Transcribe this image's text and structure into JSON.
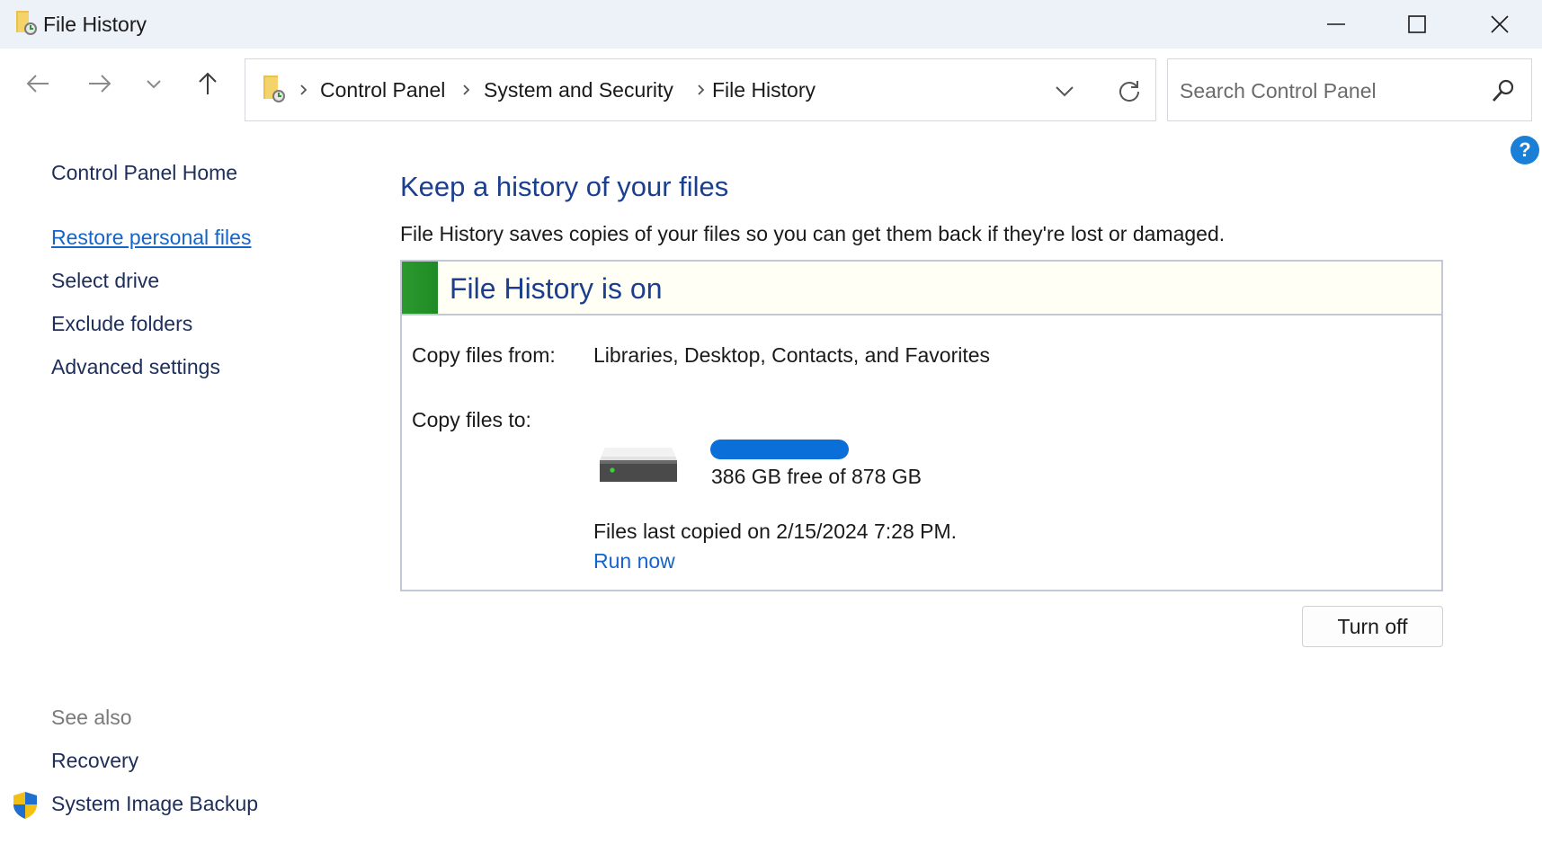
{
  "window": {
    "title": "File History",
    "minimize_icon": "minimize-icon",
    "maximize_icon": "maximize-icon",
    "close_icon": "close-icon"
  },
  "nav": {
    "breadcrumb": [
      "Control Panel",
      "System and Security",
      "File History"
    ],
    "search_placeholder": "Search Control Panel"
  },
  "sidebar": {
    "items": [
      {
        "label": "Control Panel Home"
      },
      {
        "label": "Restore personal files",
        "active": true
      },
      {
        "label": "Select drive"
      },
      {
        "label": "Exclude folders"
      },
      {
        "label": "Advanced settings"
      }
    ],
    "see_also_label": "See also",
    "see_also": [
      {
        "label": "Recovery"
      },
      {
        "label": "System Image Backup"
      }
    ]
  },
  "main": {
    "title": "Keep a history of your files",
    "description": "File History saves copies of your files so you can get them back if they're lost or damaged.",
    "status": "File History is on",
    "copy_from_label": "Copy files from:",
    "copy_from_value": "Libraries, Desktop, Contacts, and Favorites",
    "copy_to_label": "Copy files to:",
    "drive_space": "386 GB free of 878 GB",
    "last_copied": "Files last copied on 2/15/2024 7:28 PM.",
    "run_now": "Run now",
    "turn_off": "Turn off"
  },
  "colors": {
    "accent_link": "#1565c9",
    "heading": "#1b3f8f",
    "status_green": "#2a9a2e",
    "titlebar": "#edf1f8"
  }
}
